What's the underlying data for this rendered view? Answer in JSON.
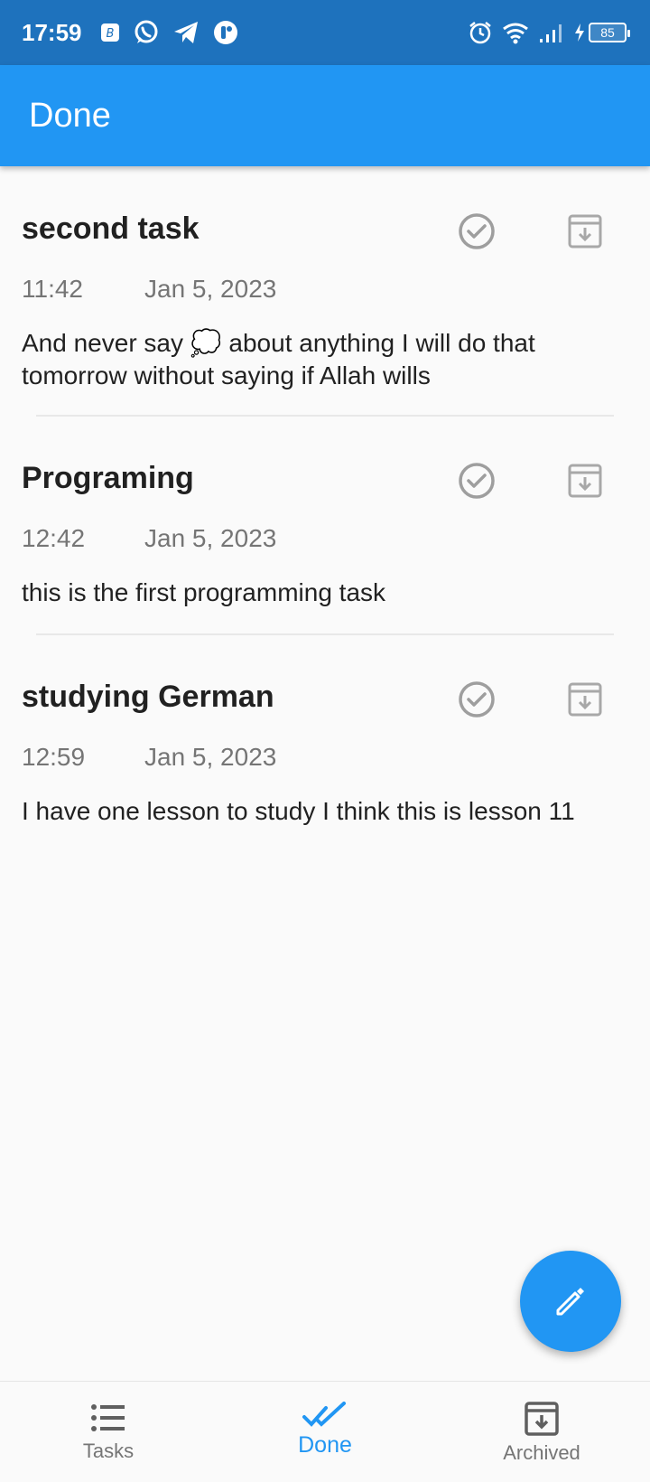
{
  "status_bar": {
    "time": "17:59",
    "battery": "85",
    "left_icons": [
      "bluetooth-app-icon",
      "whatsapp-icon",
      "telegram-icon",
      "notification-app-icon"
    ],
    "right_icons": [
      "alarm-icon",
      "wifi-icon",
      "signal-icon",
      "charging-icon",
      "battery-icon"
    ]
  },
  "app_bar": {
    "title": "Done"
  },
  "tasks": [
    {
      "title": "second task",
      "time": "11:42",
      "date": "Jan 5, 2023",
      "description_line1": "And never say 💭 about anything I will do that",
      "description_line2": "tomorrow without saying if Allah wills"
    },
    {
      "title": "Programing",
      "time": "12:42",
      "date": "Jan 5, 2023",
      "description_line1": "this is the first programming task",
      "description_line2": ""
    },
    {
      "title": "studying German",
      "time": "12:59",
      "date": "Jan 5, 2023",
      "description_line1": "I have one lesson to study I think this is lesson 11",
      "description_line2": ""
    }
  ],
  "fab": {
    "icon": "edit-pencil-icon"
  },
  "bottom_nav": {
    "items": [
      {
        "label": "Tasks",
        "icon": "list-icon",
        "active": false
      },
      {
        "label": "Done",
        "icon": "double-check-icon",
        "active": true
      },
      {
        "label": "Archived",
        "icon": "archive-icon",
        "active": false
      }
    ]
  },
  "colors": {
    "status_bar": "#1e72bd",
    "primary": "#2196f3",
    "background": "#fafafa",
    "icon_grey": "#9e9e9e",
    "secondary_text": "#757575"
  }
}
